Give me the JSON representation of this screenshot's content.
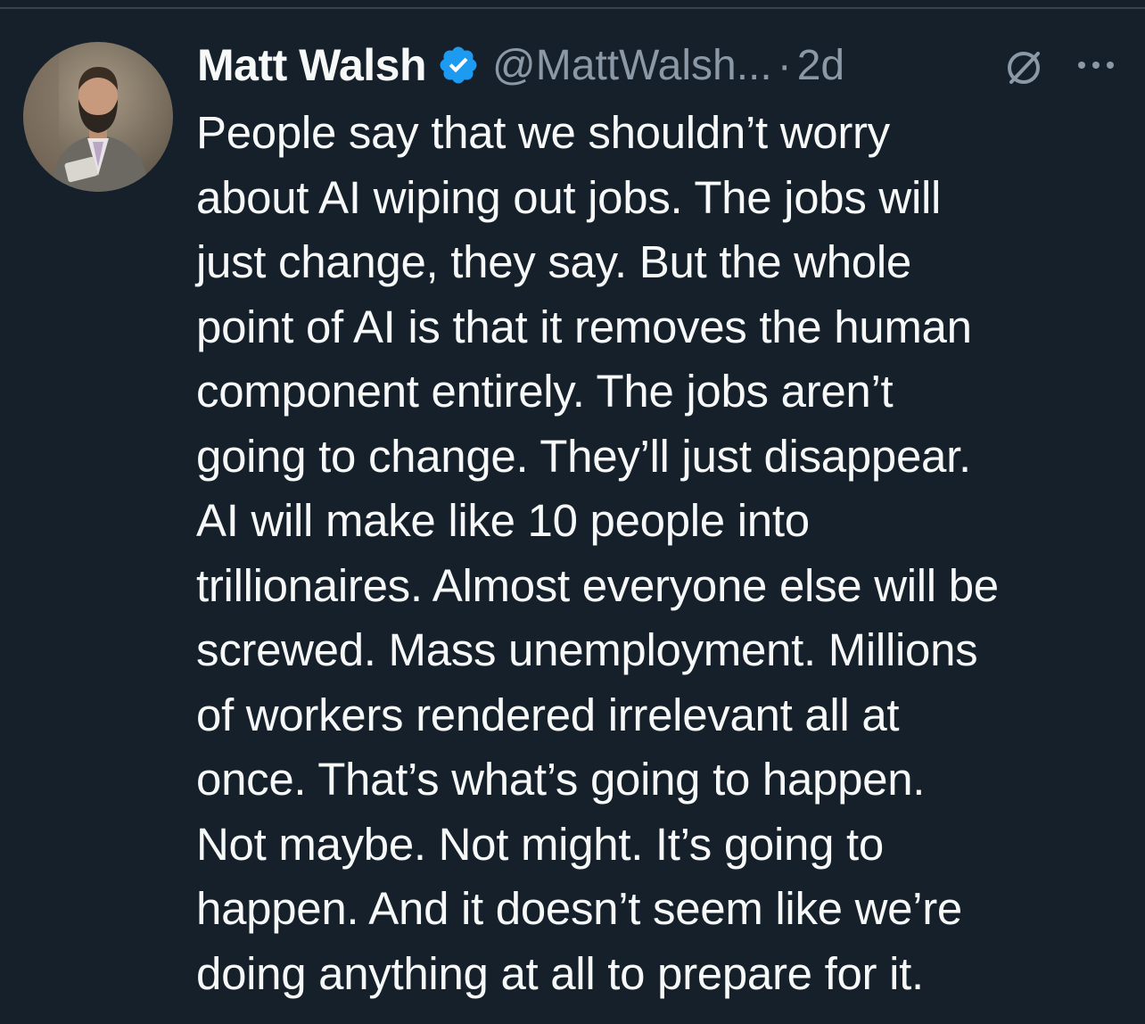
{
  "colors": {
    "background": "#15202b",
    "text_primary": "#f7f9f9",
    "text_secondary": "#8b98a5",
    "verified": "#1d9bf0",
    "divider": "#38444d"
  },
  "author": {
    "name": "Matt Walsh",
    "handle": "@MattWalsh...",
    "separator": "·",
    "time": "2d",
    "verified": true,
    "avatar_icon": "profile-photo"
  },
  "icons": {
    "verified": "verified-badge-icon",
    "muted": "circle-slash-icon",
    "more": "more-horizontal-icon"
  },
  "tweet": {
    "lines": [
      "People say that we shouldn’t worry",
      "about AI wiping out jobs. The jobs will",
      "just change, they say. But the whole",
      "point of AI is that it removes the human",
      "component entirely. The jobs aren’t",
      "going to change. They’ll just disappear.",
      "AI will make like 10 people into",
      "trillionaires. Almost everyone else will be",
      "screwed. Mass unemployment. Millions",
      "of workers rendered irrelevant all at",
      "once. That’s what’s going to happen.",
      "Not maybe. Not might. It’s going to",
      "happen. And it doesn’t seem like we’re",
      "doing anything at all to prepare for it."
    ]
  }
}
